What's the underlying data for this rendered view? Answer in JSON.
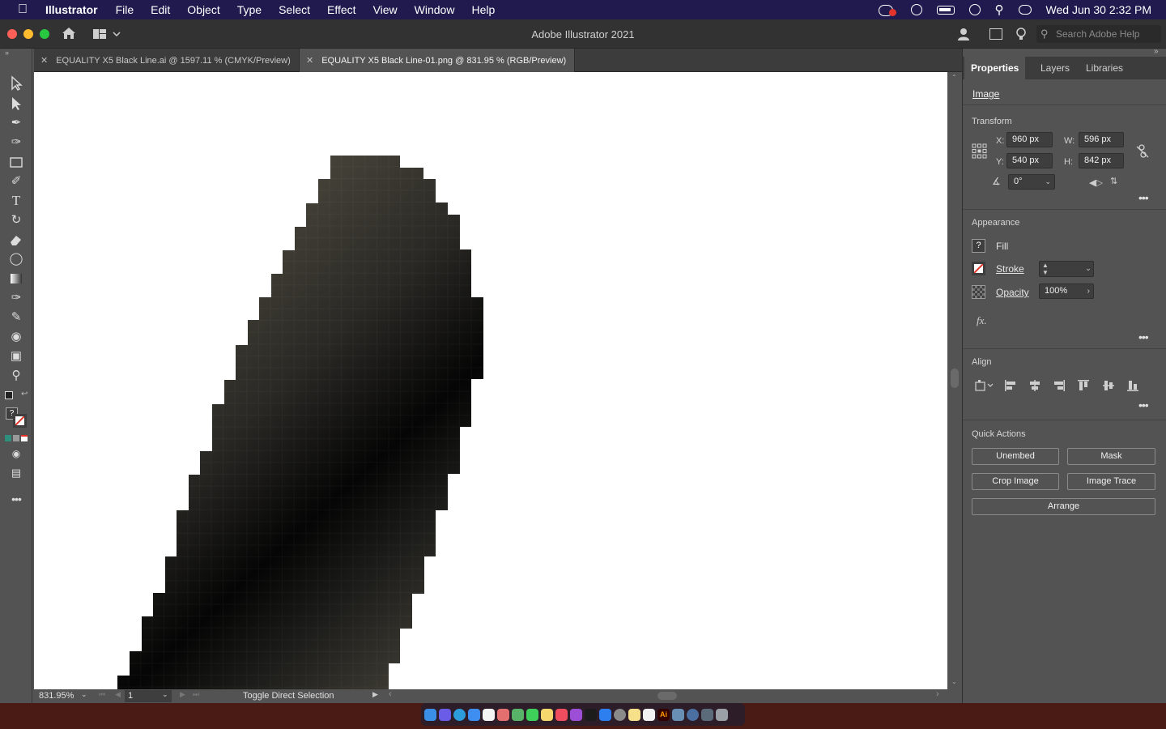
{
  "menubar": {
    "app_name": "Illustrator",
    "items": [
      "File",
      "Edit",
      "Object",
      "Type",
      "Select",
      "Effect",
      "View",
      "Window",
      "Help"
    ],
    "clock": "Wed Jun 30  2:32 PM"
  },
  "window": {
    "title": "Adobe Illustrator 2021",
    "search_placeholder": "Search Adobe Help"
  },
  "tabs": [
    {
      "label": "EQUALITY X5 Black Line.ai @ 1597.11 % (CMYK/Preview)",
      "active": false
    },
    {
      "label": "EQUALITY X5 Black Line-01.png @ 831.95 % (RGB/Preview)",
      "active": true
    }
  ],
  "statusbar": {
    "zoom": "831.95%",
    "artboard": "1",
    "tool_hint": "Toggle Direct Selection"
  },
  "panel": {
    "tabs": [
      "Properties",
      "Layers",
      "Libraries"
    ],
    "selection_type": "Image",
    "transform": {
      "title": "Transform",
      "x_label": "X:",
      "x": "960 px",
      "y_label": "Y:",
      "y": "540 px",
      "w_label": "W:",
      "w": "596 px",
      "h_label": "H:",
      "h": "842 px",
      "angle": "0°"
    },
    "appearance": {
      "title": "Appearance",
      "fill_label": "Fill",
      "stroke_label": "Stroke",
      "opacity_label": "Opacity",
      "opacity": "100%",
      "fx_label": "fx."
    },
    "align": {
      "title": "Align"
    },
    "quick_actions": {
      "title": "Quick Actions",
      "unembed": "Unembed",
      "mask": "Mask",
      "crop_image": "Crop Image",
      "image_trace": "Image Trace",
      "arrange": "Arrange"
    }
  },
  "colors": {
    "menubar_bg": "#211a4e",
    "ui_bg": "#535353",
    "stroke_red": "#e2342b",
    "pixel_dark": "#050505",
    "pixel_light": "#5c5849"
  }
}
